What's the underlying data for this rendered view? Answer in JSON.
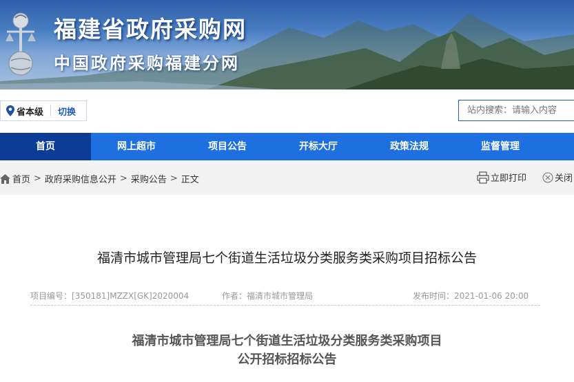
{
  "header": {
    "site_title": "福建省政府采购网",
    "site_subtitle": "中国政府采购福建分网"
  },
  "region": {
    "level": "省本级",
    "switch_label": "切换"
  },
  "search": {
    "placeholder": "站内搜索：请输入内容"
  },
  "nav": {
    "items": [
      {
        "label": "首页",
        "active": true
      },
      {
        "label": "网上超市"
      },
      {
        "label": "项目公告"
      },
      {
        "label": "开标大厅"
      },
      {
        "label": "政策法规"
      },
      {
        "label": "监督管理"
      }
    ]
  },
  "breadcrumb": [
    "首页",
    "政府采购信息公开",
    "采购公告",
    "正文"
  ],
  "actions": {
    "print": "立即打印",
    "close": "关闭"
  },
  "article": {
    "title": "福清市城市管理局七个街道生活垃圾分类服务类采购项目招标公告",
    "meta": {
      "project_no_label": "项目编号：",
      "project_no": "[350181]MZZX[GK]2020004",
      "author_label": "作者：",
      "author": "福清市城市管理局",
      "time_label": "发布时间：",
      "time": "2021-01-06 20:00"
    },
    "doc_title_line1": "福清市城市管理局七个街道生活垃圾分类服务类采购项目",
    "doc_title_line2": "公开招标招标公告"
  },
  "colors": {
    "nav_bg": "#1e6fe0",
    "nav_active": "#0b3d96",
    "link_blue": "#1e5bb5"
  }
}
